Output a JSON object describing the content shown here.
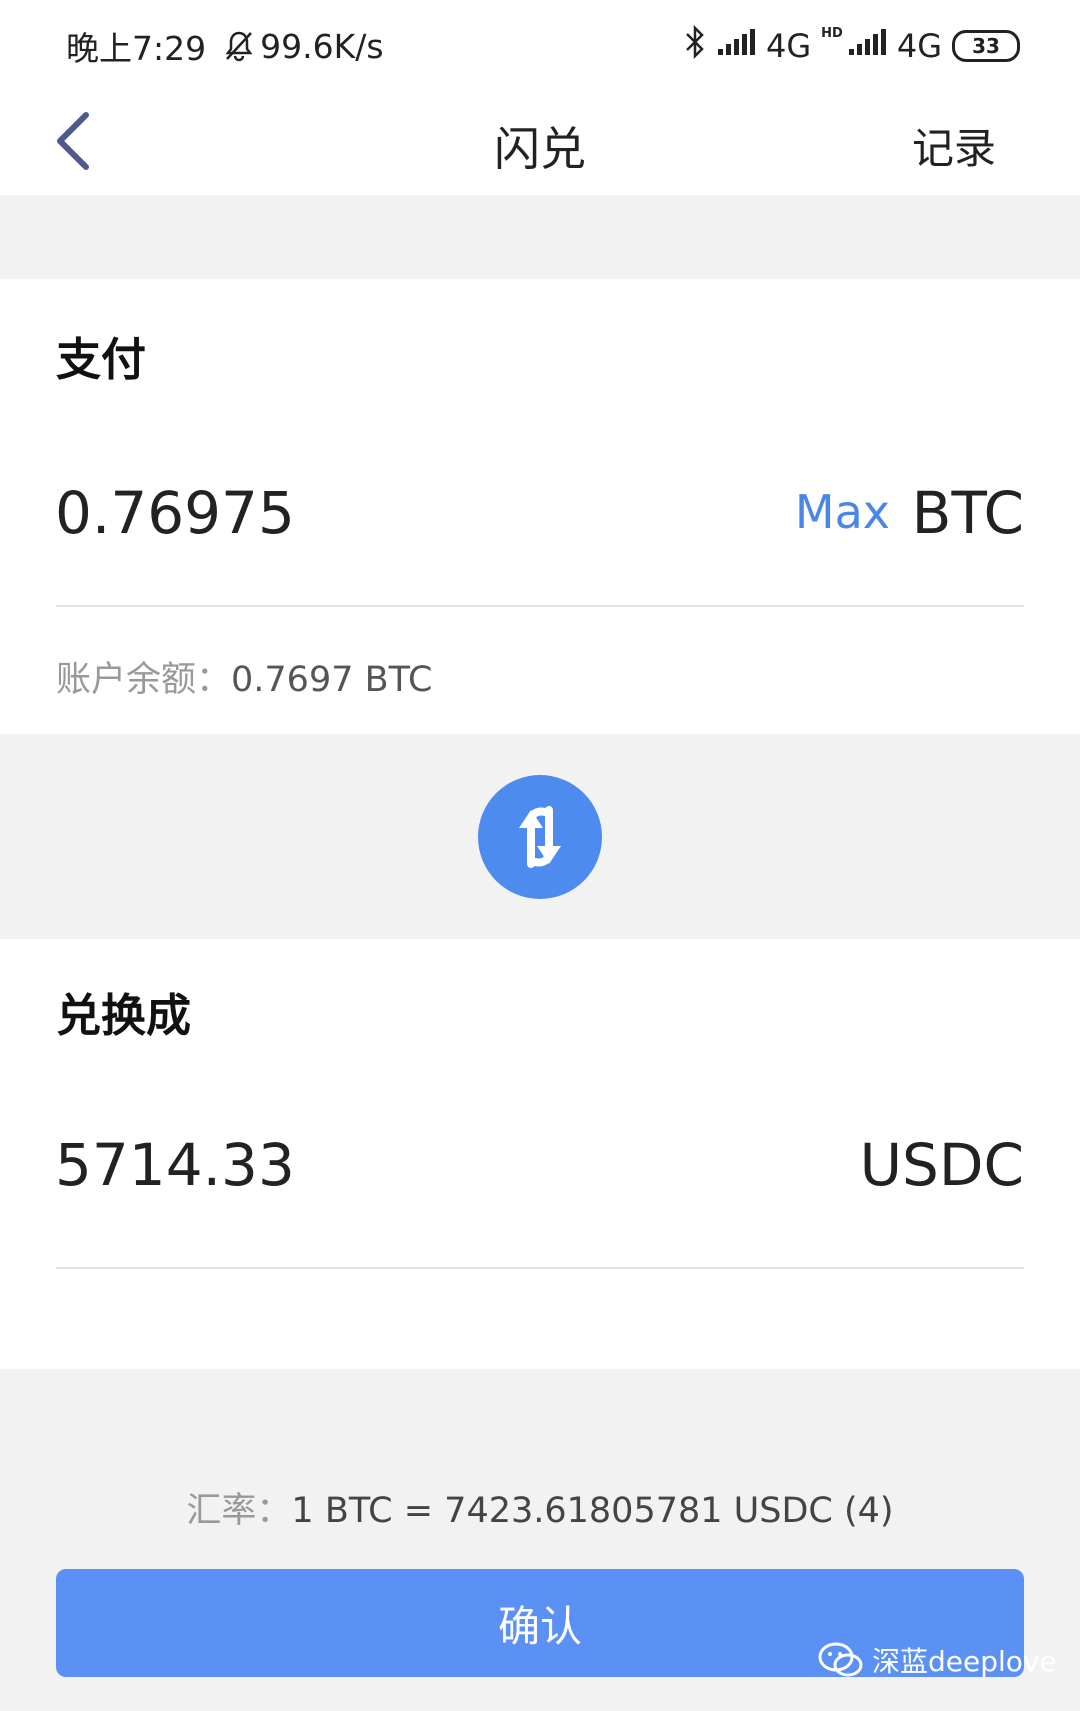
{
  "status_bar": {
    "time": "晚上7:29",
    "speed": "99.6K/s",
    "net1": "4G",
    "net2": "4G",
    "hd": "HD",
    "battery": "33"
  },
  "nav": {
    "title": "闪兑",
    "record": "记录"
  },
  "pay": {
    "title": "支付",
    "amount": "0.76975",
    "max_label": "Max",
    "currency": "BTC",
    "balance_label": "账户余额：",
    "balance_value": "0.7697 BTC"
  },
  "receive": {
    "title": "兑换成",
    "amount": "5714.33",
    "currency": "USDC"
  },
  "rate": {
    "label": "汇率：",
    "value": "1 BTC = 7423.61805781 USDC (4)"
  },
  "confirm_label": "确认",
  "watermark": "深蓝deeplove",
  "colors": {
    "accent": "#4a86e8",
    "button": "#5b91f5",
    "background": "#f2f2f2"
  }
}
